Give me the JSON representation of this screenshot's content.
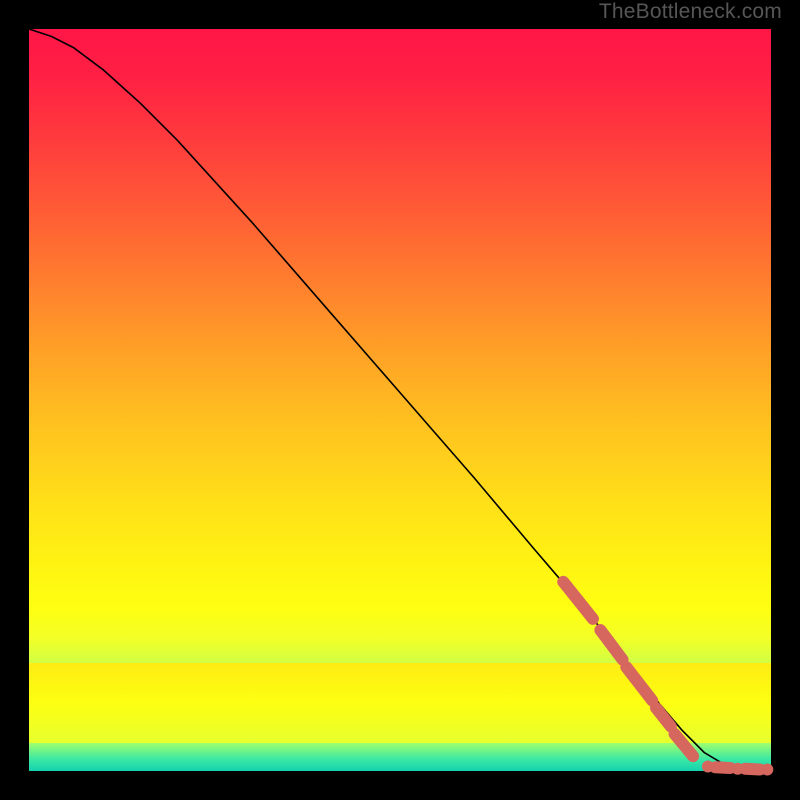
{
  "attribution": "TheBottleneck.com",
  "palette": {
    "curve_stroke": "#000000",
    "dash_color": "#d6675f",
    "gradient_top": "#ff1647",
    "gradient_bottom": "#15d4ae"
  },
  "chart_data": {
    "type": "line",
    "title": "",
    "xlabel": "",
    "ylabel": "",
    "xlim": [
      0,
      100
    ],
    "ylim": [
      0,
      100
    ],
    "grid": false,
    "legend": false,
    "series": [
      {
        "name": "curve",
        "x": [
          0,
          3,
          6,
          10,
          15,
          20,
          30,
          40,
          50,
          60,
          68,
          74,
          78,
          82,
          85,
          88,
          91,
          94,
          97,
          100
        ],
        "y": [
          100,
          99,
          97.5,
          94.5,
          90,
          85,
          74,
          62.5,
          51,
          39.5,
          30,
          23,
          18,
          13,
          9,
          5.5,
          2.5,
          0.7,
          0.2,
          0.1
        ]
      }
    ],
    "dash_overlay": {
      "segments": [
        {
          "x1": 72,
          "y1": 25.5,
          "x2": 76,
          "y2": 20.5
        },
        {
          "x1": 77,
          "y1": 19,
          "x2": 80,
          "y2": 15
        },
        {
          "x1": 80.5,
          "y1": 14,
          "x2": 84,
          "y2": 9.5
        },
        {
          "x1": 84.5,
          "y1": 8.5,
          "x2": 86.5,
          "y2": 6
        },
        {
          "x1": 87,
          "y1": 5,
          "x2": 89.5,
          "y2": 2
        }
      ],
      "dots": [
        {
          "x": 91.5,
          "y": 0.6
        },
        {
          "x": 95.5,
          "y": 0.3
        },
        {
          "x": 99.5,
          "y": 0.2
        }
      ],
      "short_segments": [
        {
          "x1": 92.5,
          "y1": 0.5,
          "x2": 94.5,
          "y2": 0.4
        },
        {
          "x1": 96.5,
          "y1": 0.3,
          "x2": 98.5,
          "y2": 0.2
        }
      ]
    }
  }
}
